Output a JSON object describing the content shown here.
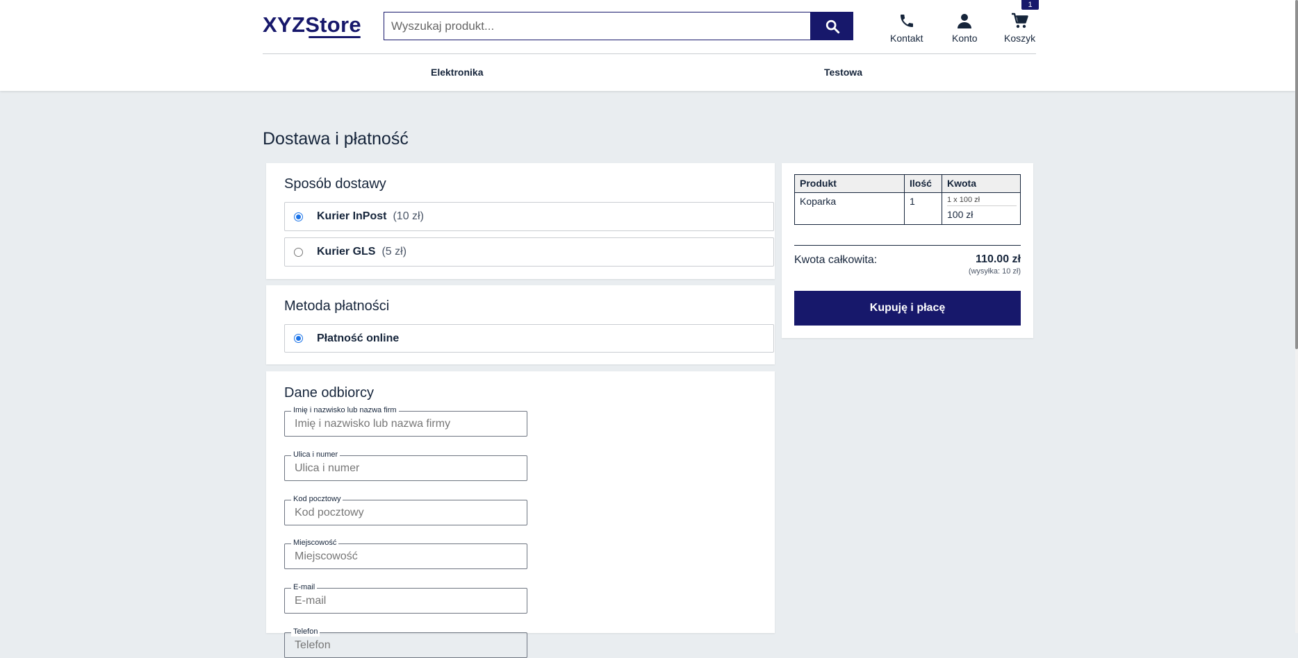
{
  "header": {
    "logo": "XYZStore",
    "search": {
      "placeholder": "Wyszukaj produkt..."
    },
    "nav": {
      "contact": "Kontakt",
      "account": "Konto",
      "cart": "Koszyk"
    },
    "cart_count": "1",
    "categories": [
      "Elektronika",
      "Testowa"
    ]
  },
  "page": {
    "title": "Dostawa i płatność"
  },
  "delivery": {
    "title": "Sposób dostawy",
    "options": [
      {
        "name": "Kurier InPost",
        "price": "(10 zł)",
        "selected": true
      },
      {
        "name": "Kurier GLS",
        "price": "(5 zł)",
        "selected": false
      }
    ]
  },
  "payment": {
    "title": "Metoda płatności",
    "options": [
      {
        "name": "Płatność online",
        "selected": true
      }
    ]
  },
  "recipient": {
    "title": "Dane odbiorcy",
    "fields": [
      {
        "label": "Imię i nazwisko lub nazwa firm",
        "placeholder": "Imię i nazwisko lub nazwa firmy",
        "value": ""
      },
      {
        "label": "Ulica i numer",
        "placeholder": "Ulica i numer",
        "value": ""
      },
      {
        "label": "Kod pocztowy",
        "placeholder": "Kod pocztowy",
        "value": ""
      },
      {
        "label": "Miejscowość",
        "placeholder": "Miejscowość",
        "value": ""
      },
      {
        "label": "E-mail",
        "placeholder": "E-mail",
        "value": ""
      },
      {
        "label": "Telefon",
        "placeholder": "Telefon",
        "value": ""
      }
    ]
  },
  "summary": {
    "columns": [
      "Produkt",
      "Ilość",
      "Kwota"
    ],
    "rows": [
      {
        "product": "Koparka",
        "quantity": "1",
        "unit": "1 x 100 zł",
        "total": "100 zł"
      }
    ],
    "total_label": "Kwota całkowita:",
    "total_value": "110.00 zł",
    "shipping_note": "(wysyłka: 10 zł)",
    "buy_label": "Kupuję i płacę"
  },
  "colors": {
    "primary": "#17186b",
    "background": "#e9edf0",
    "text": "#15243a",
    "radio": "#1a73e8"
  }
}
